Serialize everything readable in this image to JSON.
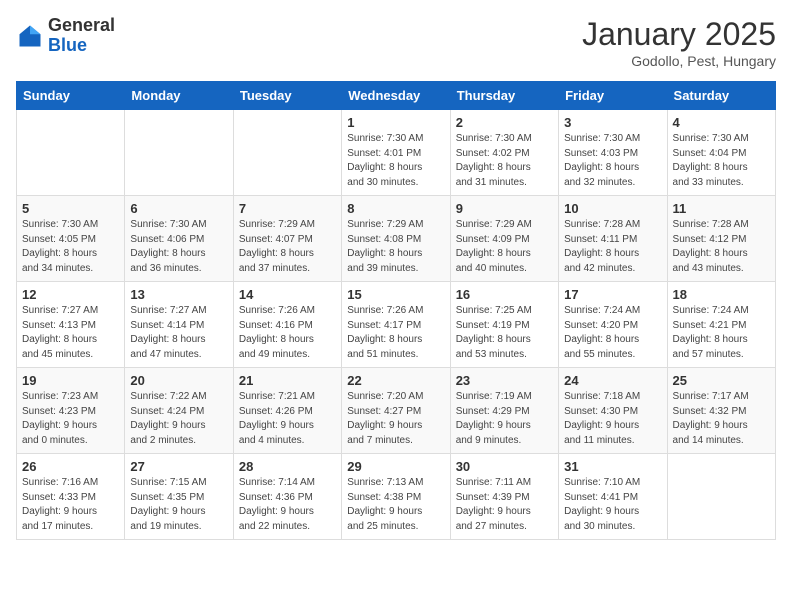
{
  "header": {
    "logo_general": "General",
    "logo_blue": "Blue",
    "title": "January 2025",
    "subtitle": "Godollo, Pest, Hungary"
  },
  "weekdays": [
    "Sunday",
    "Monday",
    "Tuesday",
    "Wednesday",
    "Thursday",
    "Friday",
    "Saturday"
  ],
  "weeks": [
    [
      {
        "day": "",
        "info": ""
      },
      {
        "day": "",
        "info": ""
      },
      {
        "day": "",
        "info": ""
      },
      {
        "day": "1",
        "info": "Sunrise: 7:30 AM\nSunset: 4:01 PM\nDaylight: 8 hours\nand 30 minutes."
      },
      {
        "day": "2",
        "info": "Sunrise: 7:30 AM\nSunset: 4:02 PM\nDaylight: 8 hours\nand 31 minutes."
      },
      {
        "day": "3",
        "info": "Sunrise: 7:30 AM\nSunset: 4:03 PM\nDaylight: 8 hours\nand 32 minutes."
      },
      {
        "day": "4",
        "info": "Sunrise: 7:30 AM\nSunset: 4:04 PM\nDaylight: 8 hours\nand 33 minutes."
      }
    ],
    [
      {
        "day": "5",
        "info": "Sunrise: 7:30 AM\nSunset: 4:05 PM\nDaylight: 8 hours\nand 34 minutes."
      },
      {
        "day": "6",
        "info": "Sunrise: 7:30 AM\nSunset: 4:06 PM\nDaylight: 8 hours\nand 36 minutes."
      },
      {
        "day": "7",
        "info": "Sunrise: 7:29 AM\nSunset: 4:07 PM\nDaylight: 8 hours\nand 37 minutes."
      },
      {
        "day": "8",
        "info": "Sunrise: 7:29 AM\nSunset: 4:08 PM\nDaylight: 8 hours\nand 39 minutes."
      },
      {
        "day": "9",
        "info": "Sunrise: 7:29 AM\nSunset: 4:09 PM\nDaylight: 8 hours\nand 40 minutes."
      },
      {
        "day": "10",
        "info": "Sunrise: 7:28 AM\nSunset: 4:11 PM\nDaylight: 8 hours\nand 42 minutes."
      },
      {
        "day": "11",
        "info": "Sunrise: 7:28 AM\nSunset: 4:12 PM\nDaylight: 8 hours\nand 43 minutes."
      }
    ],
    [
      {
        "day": "12",
        "info": "Sunrise: 7:27 AM\nSunset: 4:13 PM\nDaylight: 8 hours\nand 45 minutes."
      },
      {
        "day": "13",
        "info": "Sunrise: 7:27 AM\nSunset: 4:14 PM\nDaylight: 8 hours\nand 47 minutes."
      },
      {
        "day": "14",
        "info": "Sunrise: 7:26 AM\nSunset: 4:16 PM\nDaylight: 8 hours\nand 49 minutes."
      },
      {
        "day": "15",
        "info": "Sunrise: 7:26 AM\nSunset: 4:17 PM\nDaylight: 8 hours\nand 51 minutes."
      },
      {
        "day": "16",
        "info": "Sunrise: 7:25 AM\nSunset: 4:19 PM\nDaylight: 8 hours\nand 53 minutes."
      },
      {
        "day": "17",
        "info": "Sunrise: 7:24 AM\nSunset: 4:20 PM\nDaylight: 8 hours\nand 55 minutes."
      },
      {
        "day": "18",
        "info": "Sunrise: 7:24 AM\nSunset: 4:21 PM\nDaylight: 8 hours\nand 57 minutes."
      }
    ],
    [
      {
        "day": "19",
        "info": "Sunrise: 7:23 AM\nSunset: 4:23 PM\nDaylight: 9 hours\nand 0 minutes."
      },
      {
        "day": "20",
        "info": "Sunrise: 7:22 AM\nSunset: 4:24 PM\nDaylight: 9 hours\nand 2 minutes."
      },
      {
        "day": "21",
        "info": "Sunrise: 7:21 AM\nSunset: 4:26 PM\nDaylight: 9 hours\nand 4 minutes."
      },
      {
        "day": "22",
        "info": "Sunrise: 7:20 AM\nSunset: 4:27 PM\nDaylight: 9 hours\nand 7 minutes."
      },
      {
        "day": "23",
        "info": "Sunrise: 7:19 AM\nSunset: 4:29 PM\nDaylight: 9 hours\nand 9 minutes."
      },
      {
        "day": "24",
        "info": "Sunrise: 7:18 AM\nSunset: 4:30 PM\nDaylight: 9 hours\nand 11 minutes."
      },
      {
        "day": "25",
        "info": "Sunrise: 7:17 AM\nSunset: 4:32 PM\nDaylight: 9 hours\nand 14 minutes."
      }
    ],
    [
      {
        "day": "26",
        "info": "Sunrise: 7:16 AM\nSunset: 4:33 PM\nDaylight: 9 hours\nand 17 minutes."
      },
      {
        "day": "27",
        "info": "Sunrise: 7:15 AM\nSunset: 4:35 PM\nDaylight: 9 hours\nand 19 minutes."
      },
      {
        "day": "28",
        "info": "Sunrise: 7:14 AM\nSunset: 4:36 PM\nDaylight: 9 hours\nand 22 minutes."
      },
      {
        "day": "29",
        "info": "Sunrise: 7:13 AM\nSunset: 4:38 PM\nDaylight: 9 hours\nand 25 minutes."
      },
      {
        "day": "30",
        "info": "Sunrise: 7:11 AM\nSunset: 4:39 PM\nDaylight: 9 hours\nand 27 minutes."
      },
      {
        "day": "31",
        "info": "Sunrise: 7:10 AM\nSunset: 4:41 PM\nDaylight: 9 hours\nand 30 minutes."
      },
      {
        "day": "",
        "info": ""
      }
    ]
  ]
}
